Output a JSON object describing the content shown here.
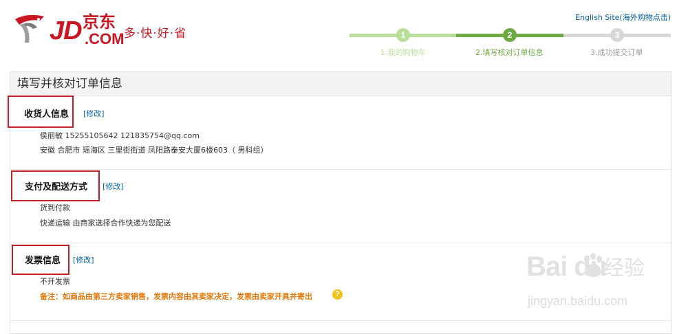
{
  "header": {
    "logo_jd": "JD",
    "logo_com": ".COM",
    "logo_jingdong": "京东",
    "slogan": "多·快·好·省",
    "english_link": "English Site(海外购物点击)"
  },
  "progress": {
    "steps": [
      {
        "number": "1",
        "label": "1.我的购物车",
        "state": "done"
      },
      {
        "number": "2",
        "label": "2.填写核对订单信息",
        "state": "current"
      },
      {
        "number": "3",
        "label": "3.成功提交订单",
        "state": "todo"
      }
    ],
    "colors": {
      "done": "#b9de9a",
      "current": "#6ea944",
      "todo": "#d7d7d7"
    }
  },
  "main": {
    "title": "填写并核对订单信息",
    "sections": [
      {
        "title": "收货人信息",
        "edit": "[修改]",
        "lines": [
          "侯丽敏    15255105642      121835754@qq.com",
          "安徽 合肥市 瑶海区 三里街街道   凤阳路泰安大厦6楼603（ 男科组）"
        ]
      },
      {
        "title": "支付及配送方式",
        "edit": "[修改]",
        "lines": [
          "货到付款",
          "快递运输   由商家选择合作快递为您配送"
        ]
      },
      {
        "title": "发票信息",
        "edit": "[修改]",
        "lines": [
          "不开发票"
        ],
        "note": "备注：如商品由第三方卖家销售，发票内容由其卖家决定，发票由卖家开具并寄出"
      }
    ],
    "help_icon": "?"
  },
  "watermark": {
    "brand": "Bai du",
    "cn": "经验",
    "url": "jingyan.baidu.com"
  },
  "colors": {
    "brand_red": "#c81623",
    "link_blue": "#005ea7",
    "highlight_red": "#c41f28",
    "note_orange": "#e4780a"
  }
}
